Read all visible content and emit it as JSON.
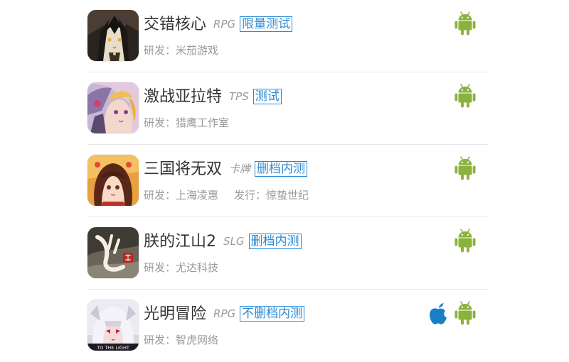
{
  "colors": {
    "android_green": "#8ab33c",
    "apple_blue": "#1a80c6",
    "badge_blue": "#2a8ad4",
    "name_text": "#333333",
    "meta_text": "#999999"
  },
  "games": [
    {
      "name": "交错核心",
      "genre": "RPG",
      "badge": "限量测试",
      "developer": "研发：米茄游戏",
      "publisher": "",
      "platforms": [
        "android-icon"
      ]
    },
    {
      "name": "激战亚拉特",
      "genre": "TPS",
      "badge": "测试",
      "developer": "研发：猎鹰工作室",
      "publisher": "",
      "platforms": [
        "android-icon"
      ]
    },
    {
      "name": "三国将无双",
      "genre": "卡牌",
      "badge": "删档内测",
      "developer": "研发：上海凌惠",
      "publisher": "发行：惊蛰世纪",
      "platforms": [
        "android-icon"
      ]
    },
    {
      "name": "朕的江山2",
      "genre": "SLG",
      "badge": "删档内测",
      "developer": "研发：尤达科技",
      "publisher": "",
      "platforms": [
        "android-icon"
      ]
    },
    {
      "name": "光明冒险",
      "genre": "RPG",
      "badge": "不删档内测",
      "developer": "研发：智虎网络",
      "publisher": "",
      "platforms": [
        "apple-icon",
        "android-icon"
      ],
      "icon_caption": "TO THE LIGHT"
    }
  ]
}
